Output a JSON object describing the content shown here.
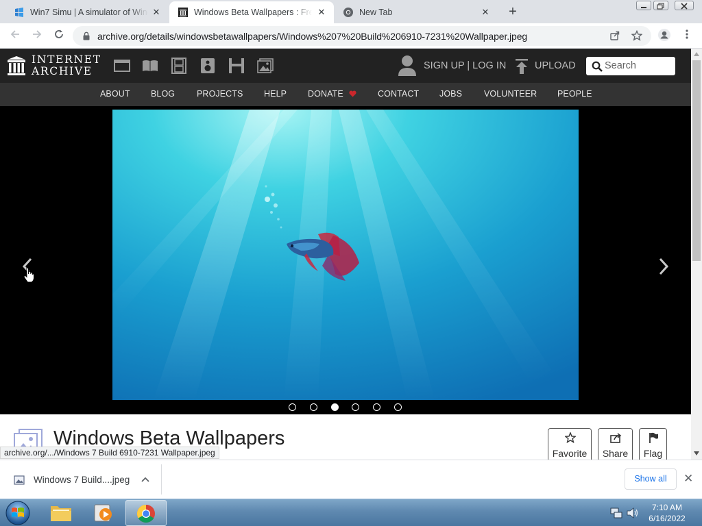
{
  "browser": {
    "tabs": [
      {
        "title": "Win7 Simu | A simulator of Windows 7",
        "icon": "win7simu-favicon"
      },
      {
        "title": "Windows Beta Wallpapers : Free Download",
        "icon": "internet-archive-favicon",
        "active": true
      },
      {
        "title": "New Tab",
        "icon": "chrome-favicon"
      }
    ],
    "url": "archive.org/details/windowsbetawallpapers/Windows%207%20Build%206910-7231%20Wallpaper.jpeg",
    "status_url": "archive.org/.../Windows 7 Build 6910-7231 Wallpaper.jpeg"
  },
  "ia": {
    "logo_line1": "INTERNET",
    "logo_line2": "ARCHIVE",
    "signup_login": "SIGN UP | LOG IN",
    "upload": "UPLOAD",
    "search_placeholder": "Search",
    "nav": [
      "ABOUT",
      "BLOG",
      "PROJECTS",
      "HELP",
      "DONATE",
      "CONTACT",
      "JOBS",
      "VOLUNTEER",
      "PEOPLE"
    ],
    "donate_heart_color": "#e0262c"
  },
  "viewer": {
    "slide_count": 6,
    "selected_slide": 3
  },
  "item": {
    "title": "Windows Beta Wallpapers",
    "actions": [
      {
        "label": "Favorite",
        "icon": "star-icon"
      },
      {
        "label": "Share",
        "icon": "share-icon"
      },
      {
        "label": "Flag",
        "icon": "flag-icon"
      }
    ]
  },
  "downloads": {
    "file_name": "Windows 7 Build....jpeg",
    "show_all": "Show all"
  },
  "taskbar": {
    "time": "7:10 AM",
    "date": "6/16/2022"
  }
}
